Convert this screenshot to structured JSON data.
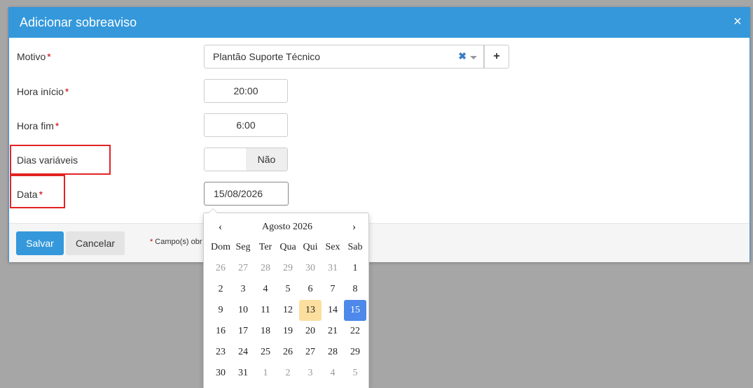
{
  "modal": {
    "title": "Adicionar sobreaviso",
    "close_symbol": "×",
    "required_marker": "*"
  },
  "form": {
    "motivo": {
      "label": "Motivo",
      "value": "Plantão Suporte Técnico",
      "clear_symbol": "✖",
      "add_symbol": "+"
    },
    "hora_inicio": {
      "label": "Hora início",
      "value": "20:00"
    },
    "hora_fim": {
      "label": "Hora fim",
      "value": "6:00"
    },
    "dias_variaveis": {
      "label": "Dias variáveis",
      "toggle_label": "Não"
    },
    "data": {
      "label": "Data",
      "value": "15/08/2026"
    }
  },
  "footer": {
    "save_label": "Salvar",
    "cancel_label": "Cancelar",
    "required_note": "Campo(s) obr"
  },
  "datepicker": {
    "month_label": "Agosto 2026",
    "prev_symbol": "‹",
    "next_symbol": "›",
    "weekdays": [
      "Dom",
      "Seg",
      "Ter",
      "Qua",
      "Qui",
      "Sex",
      "Sab"
    ],
    "weeks": [
      [
        {
          "d": "26",
          "m": true
        },
        {
          "d": "27",
          "m": true
        },
        {
          "d": "28",
          "m": true
        },
        {
          "d": "29",
          "m": true
        },
        {
          "d": "30",
          "m": true
        },
        {
          "d": "31",
          "m": true
        },
        {
          "d": "1"
        }
      ],
      [
        {
          "d": "2"
        },
        {
          "d": "3"
        },
        {
          "d": "4"
        },
        {
          "d": "5"
        },
        {
          "d": "6"
        },
        {
          "d": "7"
        },
        {
          "d": "8"
        }
      ],
      [
        {
          "d": "9"
        },
        {
          "d": "10"
        },
        {
          "d": "11"
        },
        {
          "d": "12"
        },
        {
          "d": "13",
          "today": true
        },
        {
          "d": "14"
        },
        {
          "d": "15",
          "active": true
        }
      ],
      [
        {
          "d": "16"
        },
        {
          "d": "17"
        },
        {
          "d": "18"
        },
        {
          "d": "19"
        },
        {
          "d": "20"
        },
        {
          "d": "21"
        },
        {
          "d": "22"
        }
      ],
      [
        {
          "d": "23"
        },
        {
          "d": "24"
        },
        {
          "d": "25"
        },
        {
          "d": "26"
        },
        {
          "d": "27"
        },
        {
          "d": "28"
        },
        {
          "d": "29"
        }
      ],
      [
        {
          "d": "30"
        },
        {
          "d": "31"
        },
        {
          "d": "1",
          "m": true
        },
        {
          "d": "2",
          "m": true
        },
        {
          "d": "3",
          "m": true
        },
        {
          "d": "4",
          "m": true
        },
        {
          "d": "5",
          "m": true
        }
      ]
    ]
  },
  "colors": {
    "header": "#3498db",
    "primary_button": "#3498db",
    "highlight_box": "#e32222",
    "today": "#fcdf9f",
    "selected_day": "#4d88ea",
    "required": "#cc0000"
  }
}
